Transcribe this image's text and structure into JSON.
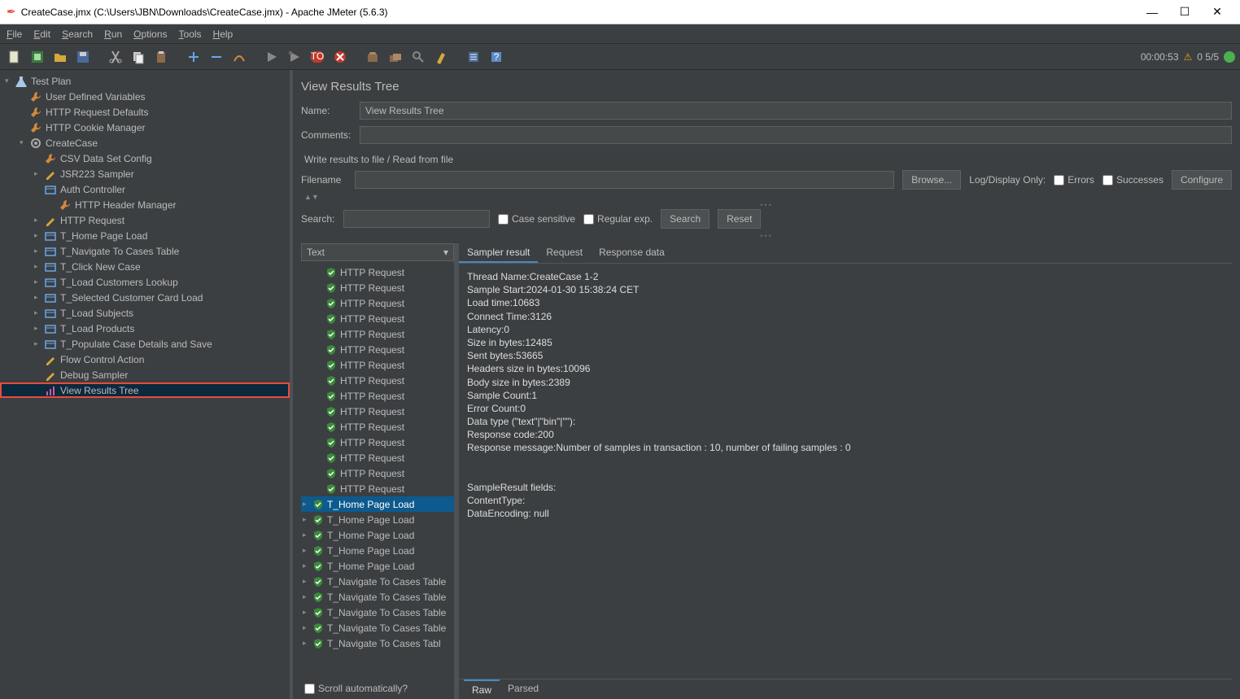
{
  "window": {
    "title": "CreateCase.jmx (C:\\Users\\JBN\\Downloads\\CreateCase.jmx) - Apache JMeter (5.6.3)"
  },
  "menu": [
    "File",
    "Edit",
    "Search",
    "Run",
    "Options",
    "Tools",
    "Help"
  ],
  "toolbar_right": {
    "time": "00:00:53",
    "threads": "0  5/5"
  },
  "tree": [
    {
      "d": 0,
      "arrow": "▾",
      "icon": "flask",
      "label": "Test Plan"
    },
    {
      "d": 1,
      "arrow": "",
      "icon": "wrench",
      "label": "User Defined Variables"
    },
    {
      "d": 1,
      "arrow": "",
      "icon": "wrench",
      "label": "HTTP Request Defaults"
    },
    {
      "d": 1,
      "arrow": "",
      "icon": "wrench",
      "label": "HTTP Cookie Manager"
    },
    {
      "d": 1,
      "arrow": "▾",
      "icon": "gear",
      "label": "CreateCase"
    },
    {
      "d": 2,
      "arrow": "",
      "icon": "wrench",
      "label": "CSV Data Set Config"
    },
    {
      "d": 2,
      "arrow": "▸",
      "icon": "pencil",
      "label": "JSR223 Sampler"
    },
    {
      "d": 2,
      "arrow": "",
      "icon": "box",
      "label": "Auth Controller"
    },
    {
      "d": 3,
      "arrow": "",
      "icon": "wrench",
      "label": "HTTP Header Manager"
    },
    {
      "d": 2,
      "arrow": "▸",
      "icon": "pencil",
      "label": "HTTP Request"
    },
    {
      "d": 2,
      "arrow": "▸",
      "icon": "box",
      "label": "T_Home Page Load"
    },
    {
      "d": 2,
      "arrow": "▸",
      "icon": "box",
      "label": "T_Navigate To Cases Table"
    },
    {
      "d": 2,
      "arrow": "▸",
      "icon": "box",
      "label": "T_Click New Case"
    },
    {
      "d": 2,
      "arrow": "▸",
      "icon": "box",
      "label": "T_Load Customers Lookup"
    },
    {
      "d": 2,
      "arrow": "▸",
      "icon": "box",
      "label": "T_Selected Customer Card Load"
    },
    {
      "d": 2,
      "arrow": "▸",
      "icon": "box",
      "label": "T_Load Subjects"
    },
    {
      "d": 2,
      "arrow": "▸",
      "icon": "box",
      "label": "T_Load Products"
    },
    {
      "d": 2,
      "arrow": "▸",
      "icon": "box",
      "label": "T_Populate Case Details and Save"
    },
    {
      "d": 2,
      "arrow": "",
      "icon": "pencil",
      "label": "Flow Control Action"
    },
    {
      "d": 2,
      "arrow": "",
      "icon": "pencil",
      "label": "Debug Sampler"
    },
    {
      "d": 2,
      "arrow": "",
      "icon": "chart",
      "label": "View Results Tree",
      "selected": true,
      "box": true
    }
  ],
  "panel": {
    "title": "View Results Tree",
    "name_label": "Name:",
    "name_value": "View Results Tree",
    "comments_label": "Comments:",
    "comments_value": "",
    "write_results_label": "Write results to file / Read from file",
    "filename_label": "Filename",
    "filename_value": "",
    "browse_btn": "Browse...",
    "log_display_label": "Log/Display Only:",
    "errors_cb": "Errors",
    "successes_cb": "Successes",
    "configure_btn": "Configure",
    "search_label": "Search:",
    "case_cb": "Case sensitive",
    "regex_cb": "Regular exp.",
    "search_btn": "Search",
    "reset_btn": "Reset",
    "combo_value": "Text",
    "scroll_cb": "Scroll automatically?"
  },
  "tabs": {
    "sampler": "Sampler result",
    "request": "Request",
    "response": "Response data"
  },
  "bottom_tabs": {
    "raw": "Raw",
    "parsed": "Parsed"
  },
  "results": [
    {
      "exp": "",
      "label": "HTTP Request",
      "indent": 1
    },
    {
      "exp": "",
      "label": "HTTP Request",
      "indent": 1
    },
    {
      "exp": "",
      "label": "HTTP Request",
      "indent": 1
    },
    {
      "exp": "",
      "label": "HTTP Request",
      "indent": 1
    },
    {
      "exp": "",
      "label": "HTTP Request",
      "indent": 1
    },
    {
      "exp": "",
      "label": "HTTP Request",
      "indent": 1
    },
    {
      "exp": "",
      "label": "HTTP Request",
      "indent": 1
    },
    {
      "exp": "",
      "label": "HTTP Request",
      "indent": 1
    },
    {
      "exp": "",
      "label": "HTTP Request",
      "indent": 1
    },
    {
      "exp": "",
      "label": "HTTP Request",
      "indent": 1
    },
    {
      "exp": "",
      "label": "HTTP Request",
      "indent": 1
    },
    {
      "exp": "",
      "label": "HTTP Request",
      "indent": 1
    },
    {
      "exp": "",
      "label": "HTTP Request",
      "indent": 1
    },
    {
      "exp": "",
      "label": "HTTP Request",
      "indent": 1
    },
    {
      "exp": "",
      "label": "HTTP Request",
      "indent": 1
    },
    {
      "exp": "▸",
      "label": "T_Home Page Load",
      "sel": true,
      "indent": 0
    },
    {
      "exp": "▸",
      "label": "T_Home Page Load",
      "indent": 0
    },
    {
      "exp": "▸",
      "label": "T_Home Page Load",
      "indent": 0
    },
    {
      "exp": "▸",
      "label": "T_Home Page Load",
      "indent": 0
    },
    {
      "exp": "▸",
      "label": "T_Home Page Load",
      "indent": 0
    },
    {
      "exp": "▸",
      "label": "T_Navigate To Cases Table",
      "indent": 0
    },
    {
      "exp": "▸",
      "label": "T_Navigate To Cases Table",
      "indent": 0
    },
    {
      "exp": "▸",
      "label": "T_Navigate To Cases Table",
      "indent": 0
    },
    {
      "exp": "▸",
      "label": "T_Navigate To Cases Table",
      "indent": 0
    },
    {
      "exp": "▸",
      "label": "T_Navigate To Cases Tabl",
      "indent": 0
    }
  ],
  "sampler_result": [
    "Thread Name:CreateCase 1-2",
    "Sample Start:2024-01-30 15:38:24 CET",
    "Load time:10683",
    "Connect Time:3126",
    "Latency:0",
    "Size in bytes:12485",
    "Sent bytes:53665",
    "Headers size in bytes:10096",
    "Body size in bytes:2389",
    "Sample Count:1",
    "Error Count:0",
    "Data type (\"text\"|\"bin\"|\"\"):",
    "Response code:200",
    "Response message:Number of samples in transaction : 10, number of failing samples : 0",
    "",
    "",
    "SampleResult fields:",
    "ContentType:",
    "DataEncoding: null"
  ]
}
